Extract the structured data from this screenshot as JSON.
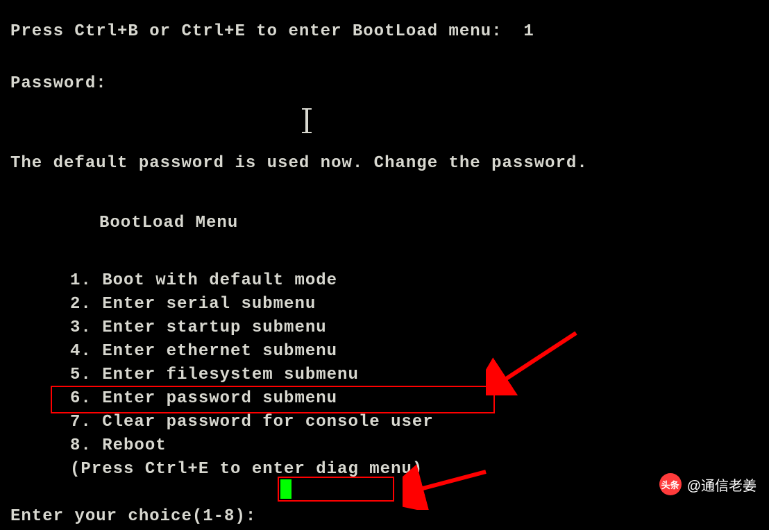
{
  "prompt": {
    "bootload_hint": "Press Ctrl+B or Ctrl+E to enter BootLoad menu:  1",
    "password_label": "Password:",
    "status_message": "The default password is used now. Change the password."
  },
  "menu": {
    "title": "BootLoad Menu",
    "items": [
      "1. Boot with default mode",
      "2. Enter serial submenu",
      "3. Enter startup submenu",
      "4. Enter ethernet submenu",
      "5. Enter filesystem submenu",
      "6. Enter password submenu",
      "7. Clear password for console user",
      "8. Reboot"
    ],
    "hint": "(Press Ctrl+E to enter diag menu)"
  },
  "choice_prompt": "Enter your choice(1-8):",
  "watermark": {
    "badge": "头条",
    "text": "@通信老姜"
  },
  "annotations": {
    "arrow1": "arrow-annotation",
    "arrow2": "arrow-annotation",
    "highlight1": "highlight-box",
    "highlight2": "highlight-box"
  }
}
